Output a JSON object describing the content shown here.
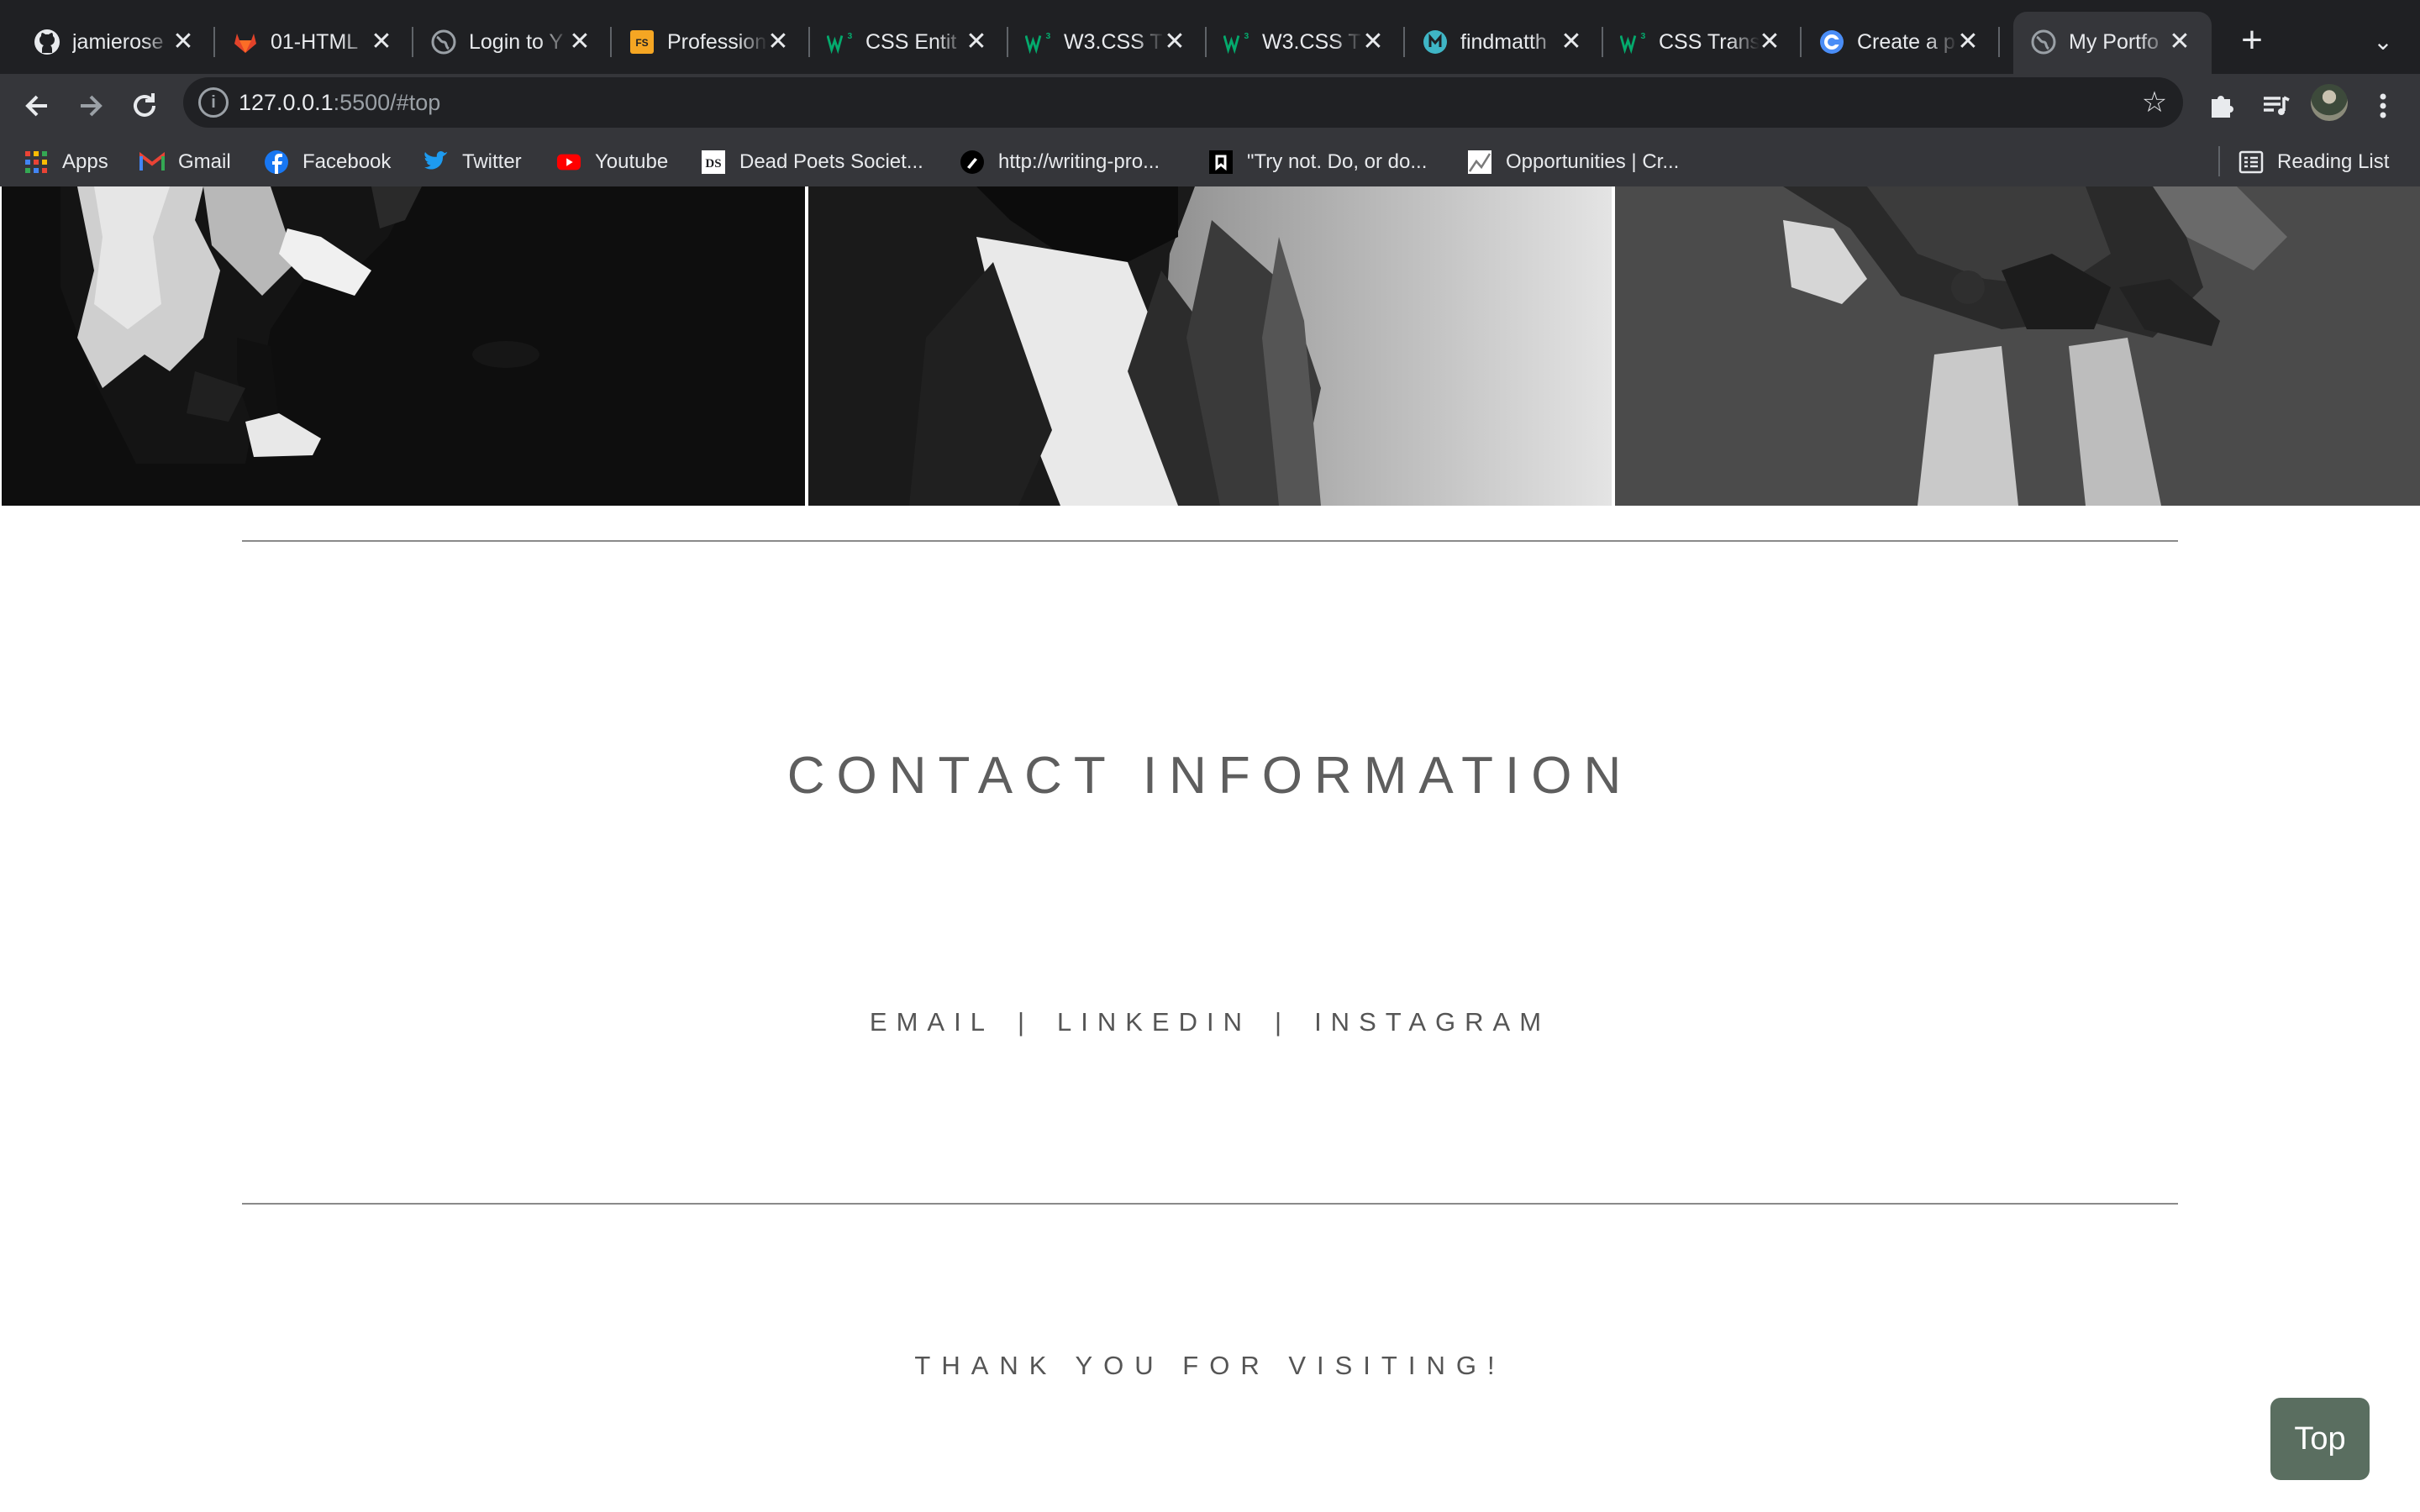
{
  "browser": {
    "tabs": [
      {
        "title": "jamierose",
        "icon": "github-icon"
      },
      {
        "title": "01-HTML",
        "icon": "gitlab-icon"
      },
      {
        "title": "Login to Y",
        "icon": "globe-icon"
      },
      {
        "title": "Profession",
        "icon": "fs-icon"
      },
      {
        "title": "CSS Entit",
        "icon": "w3schools-icon"
      },
      {
        "title": "W3.CSS T",
        "icon": "w3schools-icon"
      },
      {
        "title": "W3.CSS T",
        "icon": "w3schools-icon"
      },
      {
        "title": "findmatth",
        "icon": "hex-icon"
      },
      {
        "title": "CSS Trans",
        "icon": "w3schools-icon"
      },
      {
        "title": "Create a p",
        "icon": "c-icon"
      },
      {
        "title": "My Portfo",
        "icon": "globe-icon",
        "active": true
      }
    ],
    "address": {
      "host": "127.0.0.1",
      "rest": ":5500/#top"
    },
    "bookmarks": [
      {
        "label": "Apps",
        "icon": "apps-grid-icon"
      },
      {
        "label": "Gmail",
        "icon": "gmail-icon"
      },
      {
        "label": "Facebook",
        "icon": "facebook-icon"
      },
      {
        "label": "Twitter",
        "icon": "twitter-icon"
      },
      {
        "label": "Youtube",
        "icon": "youtube-icon"
      },
      {
        "label": "Dead Poets Societ...",
        "icon": "ds-icon"
      },
      {
        "label": "http://writing-pro...",
        "icon": "pen-icon"
      },
      {
        "label": "\"Try not. Do, or do...",
        "icon": "bookmark-icon"
      },
      {
        "label": "Opportunities | Cr...",
        "icon": "chart-icon"
      }
    ],
    "reading_list": "Reading List"
  },
  "page": {
    "contact_title": "CONTACT INFORMATION",
    "links": [
      "EMAIL",
      "LINKEDIN",
      "INSTAGRAM"
    ],
    "separator": "|",
    "thanks": "THANK YOU FOR VISITING!",
    "top_button": "Top"
  },
  "colors": {
    "tabstrip": "#1f2023",
    "toolbar": "#35363a",
    "top_button": "#5a6e60",
    "heading_text": "#5e5e5e"
  }
}
